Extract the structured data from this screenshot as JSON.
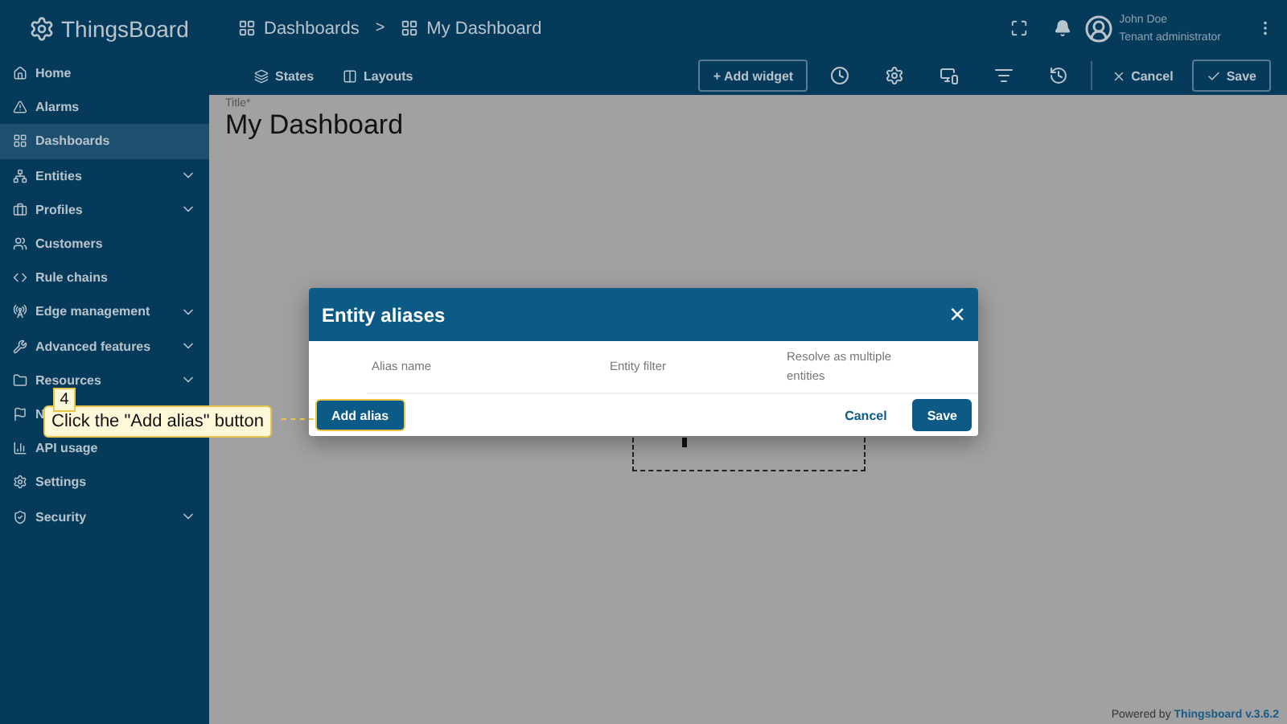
{
  "header": {
    "logo": "ThingsBoard",
    "breadcrumbs": [
      {
        "label": "Dashboards"
      },
      {
        "label": "My Dashboard"
      }
    ],
    "separator": ">",
    "user": {
      "name": "John Doe",
      "role": "Tenant administrator"
    }
  },
  "sidebar": {
    "items": [
      {
        "label": "Home",
        "selected": false,
        "expandable": false
      },
      {
        "label": "Alarms",
        "selected": false,
        "expandable": false
      },
      {
        "label": "Dashboards",
        "selected": true,
        "expandable": false
      },
      {
        "label": "Entities",
        "selected": false,
        "expandable": true
      },
      {
        "label": "Profiles",
        "selected": false,
        "expandable": true
      },
      {
        "label": "Customers",
        "selected": false,
        "expandable": false
      },
      {
        "label": "Rule chains",
        "selected": false,
        "expandable": false
      },
      {
        "label": "Edge management",
        "selected": false,
        "expandable": true
      },
      {
        "label": "Advanced features",
        "selected": false,
        "expandable": true
      },
      {
        "label": "Resources",
        "selected": false,
        "expandable": true
      },
      {
        "label": "N",
        "selected": false
      },
      {
        "label": "API usage",
        "selected": false,
        "expandable": false
      },
      {
        "label": "Settings",
        "selected": false,
        "expandable": false
      },
      {
        "label": "Security",
        "selected": false,
        "expandable": true
      }
    ]
  },
  "toolbar": {
    "tabs": [
      {
        "label": "States"
      },
      {
        "label": "Layouts"
      }
    ],
    "add_widget": "+ Add widget",
    "cancel": "Cancel",
    "save": "Save"
  },
  "dashboard": {
    "title_label": "Title*",
    "title": "My Dashboard"
  },
  "dialog": {
    "title": "Entity aliases",
    "close": "×",
    "columns": [
      "Alias name",
      "Entity filter",
      "Resolve as multiple entities"
    ],
    "add_button": "Add alias",
    "cancel": "Cancel",
    "save": "Save"
  },
  "callout": {
    "step": "4",
    "text": "Click the \"Add alias\" button"
  },
  "footer": {
    "prefix": "Powered by",
    "link": "Thingsboard v.3.6.2"
  }
}
